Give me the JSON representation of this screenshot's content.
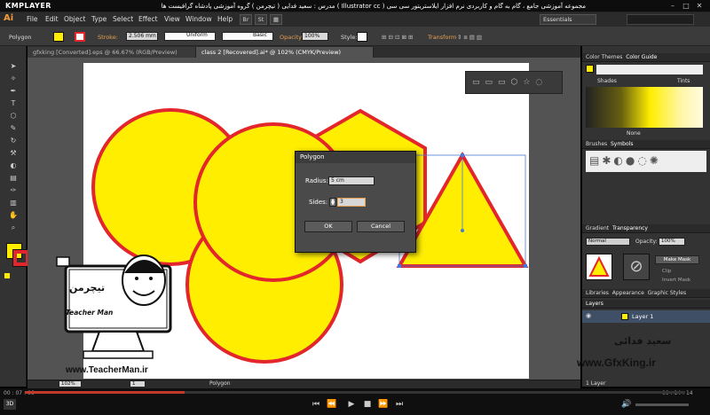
{
  "player": {
    "name": "KMPLAYER",
    "title": "مجموعه آموزشی جامع ، گام به گام و کاربردی نرم افزار ایلاستریتور سی سی ( Illustrator cc )   مدرس : سعید فدایی ( تیچرمن ) گروه آموزشی پادشاه گرافیست ها",
    "time_elapsed": "00 : 07 : 06",
    "time_total": "00 : 14 : 14"
  },
  "app": {
    "logo": "Ai",
    "menus": [
      "File",
      "Edit",
      "Object",
      "Type",
      "Select",
      "Effect",
      "View",
      "Window",
      "Help"
    ],
    "br_label": "Br",
    "st_label": "St",
    "workspace": "Essentials"
  },
  "control": {
    "object_type": "Polygon",
    "stroke_label": "Stroke:",
    "stroke_weight": "2.506 mm",
    "profile": "Uniform",
    "brush": "Basic",
    "opacity_label": "Opacity:",
    "opacity": "100%",
    "style_label": "Style:",
    "transform_label": "Transform"
  },
  "tabs": [
    "gfxking [Converted].eps @ 66.67% (RGB/Preview)",
    "class 2 [Recovered].ai* @ 102% (CMYK/Preview)"
  ],
  "status": {
    "zoom": "102%",
    "page": "1",
    "tool": "Polygon"
  },
  "dialog": {
    "title": "Polygon",
    "radius_label": "Radius:",
    "radius": "5 cm",
    "sides_label": "Sides:",
    "sides": "3",
    "ok": "OK",
    "cancel": "Cancel"
  },
  "panels": {
    "color_themes": "Color Themes",
    "color_guide": "Color Guide",
    "shades": "Shades",
    "tints": "Tints",
    "none": "None",
    "brushes": "Brushes",
    "symbols": "Symbols",
    "gradient": "Gradient",
    "transparency": "Transparency",
    "blend_mode": "Normal",
    "opacity_label": "Opacity:",
    "opacity": "100%",
    "make_mask": "Make Mask",
    "clip": "Clip",
    "invert_mask": "Invert Mask",
    "libraries": "Libraries",
    "appearance": "Appearance",
    "graphic_styles": "Graphic Styles",
    "layers": "Layers",
    "layer_name": "Layer 1",
    "layer_count": "1 Layer"
  },
  "watermark": {
    "brand": "تیچرمن",
    "brand_en": "Teacher Man",
    "url": "www.TeacherMan.ir",
    "author": "سعید فدائی",
    "site": "www.GfxKing.ir"
  },
  "colors": {
    "fill": "#ffee00",
    "stroke": "#e3262b",
    "accent": "#e8a050"
  }
}
